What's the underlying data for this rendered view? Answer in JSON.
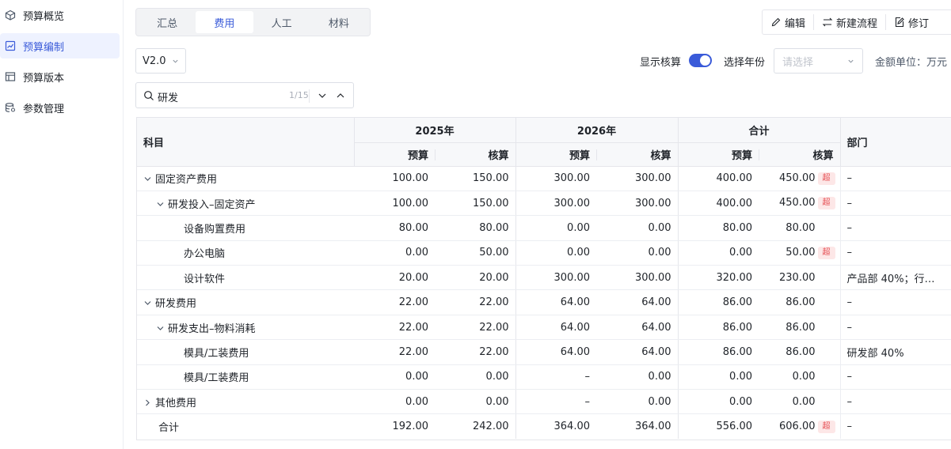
{
  "sidebar": {
    "items": [
      {
        "label": "预算概览",
        "icon": "cube-icon"
      },
      {
        "label": "预算编制",
        "icon": "chart-icon"
      },
      {
        "label": "预算版本",
        "icon": "table-icon"
      },
      {
        "label": "参数管理",
        "icon": "database-icon"
      }
    ],
    "active_index": 1
  },
  "tabs": [
    "汇总",
    "费用",
    "人工",
    "材料"
  ],
  "active_tab": 1,
  "actions": {
    "edit": "编辑",
    "new_flow": "新建流程",
    "revise": "修订"
  },
  "filters": {
    "version": "V2.0",
    "show_check_label": "显示核算",
    "show_check_on": true,
    "year_label": "选择年份",
    "year_placeholder": "请选择",
    "unit_label": "金额单位：万元"
  },
  "search": {
    "value": "研发",
    "count": "1/15"
  },
  "table": {
    "headers": {
      "subject": "科目",
      "years": [
        "2025年",
        "2026年",
        "合计"
      ],
      "budget": "预算",
      "check": "核算",
      "dept": "部门"
    },
    "rows": [
      {
        "name": "固定资产费用",
        "level": 0,
        "arrow": "down",
        "v": [
          "100.00",
          "150.00",
          "300.00",
          "300.00",
          "400.00",
          "450.00"
        ],
        "over": true,
        "dept": "–"
      },
      {
        "name": "研发投入–固定资产",
        "level": 1,
        "arrow": "down",
        "v": [
          "100.00",
          "150.00",
          "300.00",
          "300.00",
          "400.00",
          "450.00"
        ],
        "over": true,
        "dept": "–"
      },
      {
        "name": "设备购置费用",
        "level": 2,
        "arrow": "",
        "v": [
          "80.00",
          "80.00",
          "0.00",
          "0.00",
          "80.00",
          "80.00"
        ],
        "over": false,
        "dept": "–"
      },
      {
        "name": "办公电脑",
        "level": 2,
        "arrow": "",
        "v": [
          "0.00",
          "50.00",
          "0.00",
          "0.00",
          "0.00",
          "50.00"
        ],
        "over": true,
        "dept": "–"
      },
      {
        "name": "设计软件",
        "level": 2,
        "arrow": "",
        "v": [
          "20.00",
          "20.00",
          "300.00",
          "300.00",
          "320.00",
          "230.00"
        ],
        "over": false,
        "dept": "产品部 40%；行…"
      },
      {
        "name": "研发费用",
        "level": 0,
        "arrow": "down",
        "v": [
          "22.00",
          "22.00",
          "64.00",
          "64.00",
          "86.00",
          "86.00"
        ],
        "over": false,
        "dept": "–"
      },
      {
        "name": "研发支出–物料消耗",
        "level": 1,
        "arrow": "down",
        "v": [
          "22.00",
          "22.00",
          "64.00",
          "64.00",
          "86.00",
          "86.00"
        ],
        "over": false,
        "dept": "–"
      },
      {
        "name": "模具/工装费用",
        "level": 2,
        "arrow": "",
        "v": [
          "22.00",
          "22.00",
          "64.00",
          "64.00",
          "86.00",
          "86.00"
        ],
        "over": false,
        "dept": "研发部 40%"
      },
      {
        "name": "模具/工装费用",
        "level": 2,
        "arrow": "",
        "v": [
          "0.00",
          "0.00",
          "–",
          "0.00",
          "0.00",
          "0.00"
        ],
        "over": false,
        "dept": "–"
      },
      {
        "name": "其他费用",
        "level": 0,
        "arrow": "right",
        "v": [
          "0.00",
          "0.00",
          "–",
          "0.00",
          "0.00",
          "0.00"
        ],
        "over": false,
        "dept": "–"
      },
      {
        "name": "合计",
        "level": 0,
        "arrow": "",
        "v": [
          "192.00",
          "242.00",
          "364.00",
          "364.00",
          "556.00",
          "606.00"
        ],
        "over": true,
        "dept": "–",
        "total": true
      }
    ],
    "over_badge": "超"
  },
  "colors": {
    "accent": "#3a5bd9",
    "over_text": "#e5484d",
    "over_bg": "#fde7e7"
  }
}
